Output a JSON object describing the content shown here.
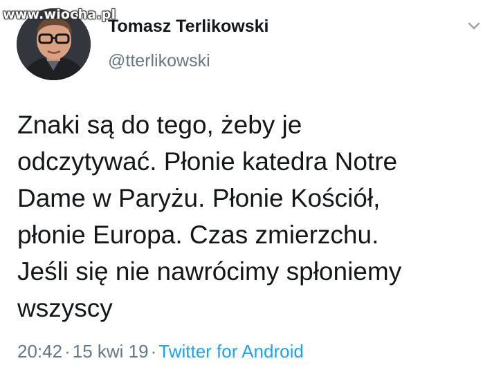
{
  "watermark": "www.wiocha.pl",
  "tweet": {
    "author": {
      "display_name": "Tomasz Terlikowski",
      "handle": "@tterlikowski"
    },
    "menu_icon": "chevron-down-icon",
    "text": "Znaki są do tego, żeby je\nodczytywać. Płonie katedra Notre\nDame w Paryżu. Płonie Kościół,\npłonie Europa. Czas zmierzchu.\nJeśli się nie nawrócimy spłoniemy\nwszyscy",
    "time": "20:42",
    "date": "15 kwi 19",
    "separator": "·",
    "source": "Twitter for Android"
  },
  "colors": {
    "text": "#14171a",
    "secondary": "#657786",
    "link": "#1da1f2",
    "background": "#ffffff"
  }
}
